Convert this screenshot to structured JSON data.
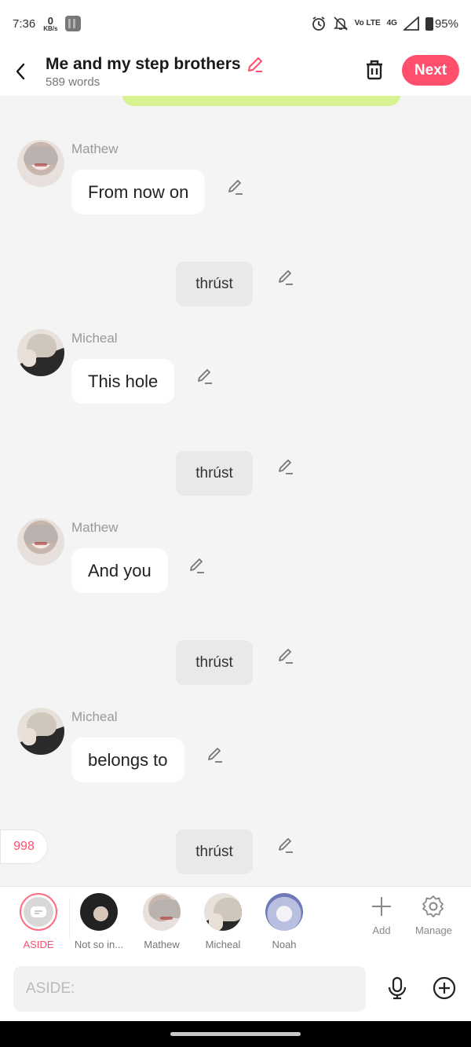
{
  "status_bar": {
    "time": "7:36",
    "kbs_value": "0",
    "kbs_unit": "KB/s",
    "network_volte": "Vo LTE",
    "network_type": "4G",
    "battery": "95%"
  },
  "header": {
    "title": "Me and my step brothers",
    "word_count": "589 words",
    "next_label": "Next"
  },
  "messages": [
    {
      "kind": "dialogue",
      "character": "Mathew",
      "text": "From now on"
    },
    {
      "kind": "action",
      "text": "thrúst"
    },
    {
      "kind": "dialogue",
      "character": "Micheal",
      "text": "This hole"
    },
    {
      "kind": "action",
      "text": "thrúst"
    },
    {
      "kind": "dialogue",
      "character": "Mathew",
      "text": "And you"
    },
    {
      "kind": "action",
      "text": "thrúst"
    },
    {
      "kind": "dialogue",
      "character": "Micheal",
      "text": "belongs to"
    },
    {
      "kind": "action",
      "text": "thrúst"
    }
  ],
  "counter": "998",
  "characters": [
    {
      "label": "ASIDE",
      "active": true
    },
    {
      "label": "Not so in..."
    },
    {
      "label": "Mathew"
    },
    {
      "label": "Micheal"
    },
    {
      "label": "Noah"
    }
  ],
  "tools": {
    "add_label": "Add",
    "manage_label": "Manage"
  },
  "input": {
    "placeholder": "ASIDE:",
    "value": ""
  },
  "colors": {
    "accent": "#ff4f6d",
    "top_strip": "#d7f290"
  },
  "icons": [
    "back-arrow-icon",
    "edit-pencil-icon",
    "trash-icon",
    "add-icon",
    "gear-icon",
    "microphone-icon",
    "plus-circle-icon",
    "alarm-icon",
    "bell-off-icon",
    "signal-icon",
    "battery-icon"
  ]
}
